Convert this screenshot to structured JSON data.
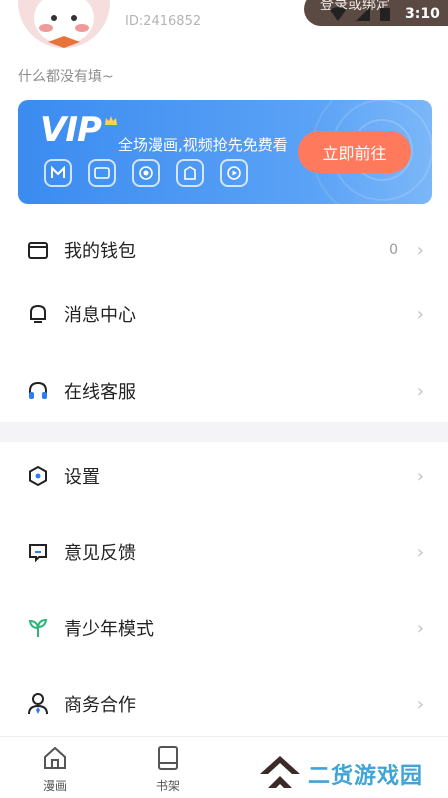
{
  "status_bar": {
    "time": "3:10"
  },
  "profile": {
    "user_id": "ID:2416852",
    "login_link": "登录或绑定",
    "bio": "什么都没有填~"
  },
  "vip": {
    "logo": "VIP",
    "description": "全场漫画,视频抢先免费看",
    "cta": "立即前往"
  },
  "menu": [
    {
      "label": "我的钱包",
      "value": "0",
      "icon": "wallet-icon"
    },
    {
      "label": "消息中心",
      "icon": "bell-icon"
    },
    {
      "label": "在线客服",
      "icon": "headset-icon"
    },
    {
      "label": "设置",
      "icon": "settings-icon"
    },
    {
      "label": "意见反馈",
      "icon": "feedback-icon"
    },
    {
      "label": "青少年模式",
      "icon": "sprout-icon"
    },
    {
      "label": "商务合作",
      "icon": "business-person-icon"
    }
  ],
  "bottom_nav": [
    {
      "label": "漫画",
      "icon": "home-icon"
    },
    {
      "label": "书架",
      "icon": "bookshelf-icon"
    }
  ],
  "watermark": "二货游戏园",
  "colors": {
    "vip_blue": "#3b8bf0",
    "cta_orange": "#ff7a5c",
    "sprout_green": "#2db67a",
    "headset_blue": "#2f7df3"
  }
}
